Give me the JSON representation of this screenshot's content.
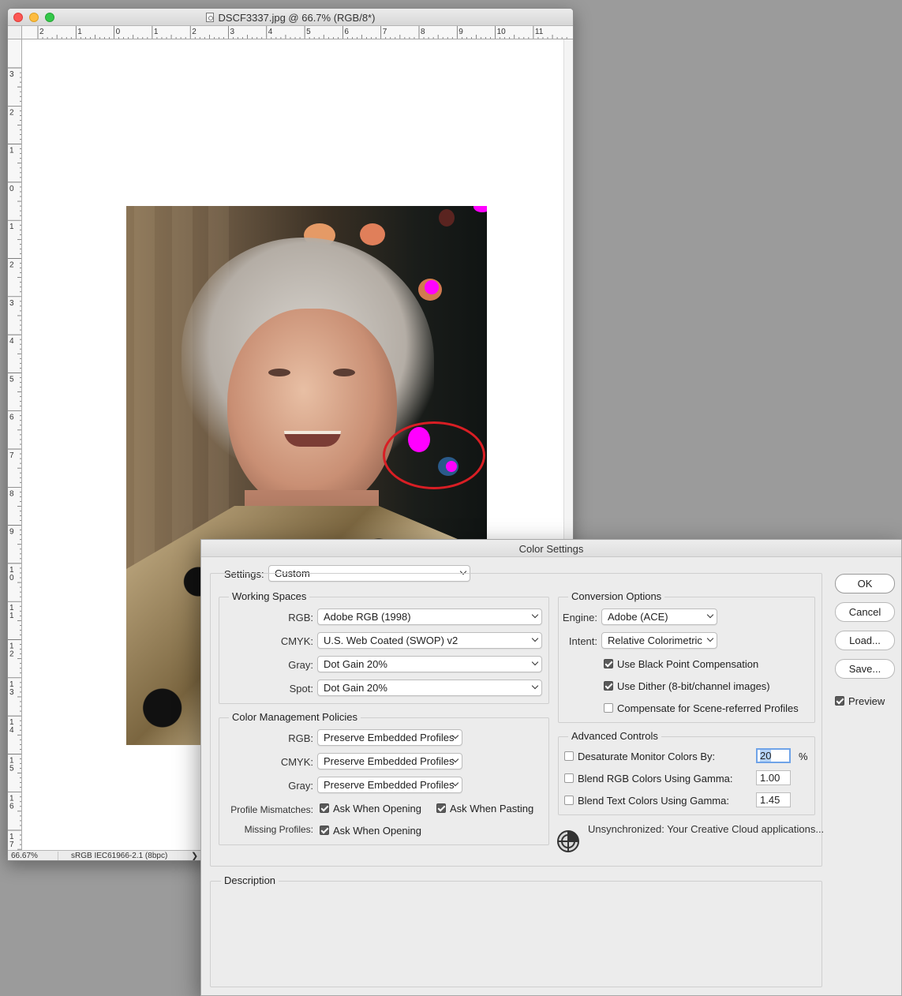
{
  "document_window": {
    "title": "DSCF3337.jpg @ 66.7% (RGB/8*)",
    "ruler_top_labels": [
      "2",
      "1",
      "0",
      "1",
      "2",
      "3",
      "4",
      "5",
      "6",
      "7",
      "8",
      "9",
      "10",
      "11"
    ],
    "ruler_left_labels": [
      "3",
      "2",
      "1",
      "0",
      "1",
      "2",
      "3",
      "4",
      "5",
      "6",
      "7",
      "8",
      "9",
      "1\n0",
      "1\n1",
      "1\n2",
      "1\n3",
      "1\n4",
      "1\n5",
      "1\n6",
      "1\n7"
    ],
    "status": {
      "zoom": "66.67%",
      "profile": "sRGB IEC61966-2.1 (8bpc)",
      "arrow": "❯"
    }
  },
  "dialog": {
    "title": "Color Settings",
    "settings_label": "Settings:",
    "settings_value": "Custom",
    "working_spaces": {
      "title": "Working Spaces",
      "rows": [
        {
          "label": "RGB:",
          "value": "Adobe RGB (1998)"
        },
        {
          "label": "CMYK:",
          "value": "U.S. Web Coated (SWOP) v2"
        },
        {
          "label": "Gray:",
          "value": "Dot Gain 20%"
        },
        {
          "label": "Spot:",
          "value": "Dot Gain 20%"
        }
      ]
    },
    "policies": {
      "title": "Color Management Policies",
      "rows": [
        {
          "label": "RGB:",
          "value": "Preserve Embedded Profiles"
        },
        {
          "label": "CMYK:",
          "value": "Preserve Embedded Profiles"
        },
        {
          "label": "Gray:",
          "value": "Preserve Embedded Profiles"
        }
      ],
      "mismatch_label": "Profile Mismatches:",
      "ask_opening": "Ask When Opening",
      "ask_pasting": "Ask When Pasting",
      "missing_label": "Missing Profiles:",
      "missing_ask_opening": "Ask When Opening"
    },
    "conversion": {
      "title": "Conversion Options",
      "engine_label": "Engine:",
      "engine_value": "Adobe (ACE)",
      "intent_label": "Intent:",
      "intent_value": "Relative Colorimetric",
      "black_point": "Use Black Point Compensation",
      "dither": "Use Dither (8-bit/channel images)",
      "scene_referred": "Compensate for Scene-referred Profiles"
    },
    "advanced": {
      "title": "Advanced Controls",
      "desaturate": "Desaturate Monitor Colors By:",
      "desaturate_value": "20",
      "percent": "%",
      "blend_rgb": "Blend RGB Colors Using Gamma:",
      "blend_rgb_value": "1.00",
      "blend_text": "Blend Text Colors Using Gamma:",
      "blend_text_value": "1.45"
    },
    "sync_message": "Unsynchronized: Your Creative Cloud applications...",
    "description_title": "Description",
    "buttons": {
      "ok": "OK",
      "cancel": "Cancel",
      "load": "Load...",
      "save": "Save..."
    },
    "preview_label": "Preview"
  },
  "colors": {
    "annotation_circle": "#d81e24",
    "bokeh_magenta": "#ff00ff",
    "focus_ring": "#6fa3e8"
  }
}
